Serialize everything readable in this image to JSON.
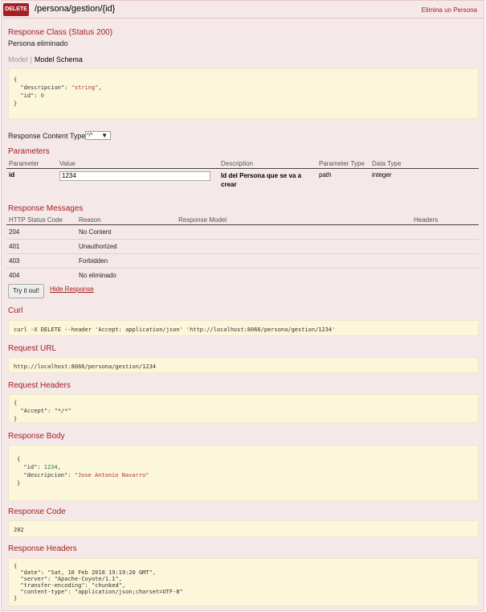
{
  "operation": {
    "method": "DELETE",
    "path": "/persona/gestion/{id}",
    "summary": "Elimina un Persona"
  },
  "response_class": {
    "title": "Response Class (Status 200)",
    "description": "Persona eliminado",
    "model_tab": "Model",
    "schema_tab": "Model Schema",
    "schema": {
      "descripcion": "string",
      "id": 0
    }
  },
  "content_type": {
    "label": "Response Content Type",
    "value": "*/*"
  },
  "parameters": {
    "title": "Parameters",
    "headers": [
      "Parameter",
      "Value",
      "Description",
      "Parameter Type",
      "Data Type"
    ],
    "rows": [
      {
        "name": "id",
        "value": "1234",
        "description": "Id del Persona que se va a crear",
        "param_type": "path",
        "data_type": "integer"
      }
    ]
  },
  "response_messages": {
    "title": "Response Messages",
    "headers": [
      "HTTP Status Code",
      "Reason",
      "Response Model",
      "Headers"
    ],
    "rows": [
      {
        "code": "204",
        "reason": "No Content"
      },
      {
        "code": "401",
        "reason": "Unauthorized"
      },
      {
        "code": "403",
        "reason": "Forbidden"
      },
      {
        "code": "404",
        "reason": "No eliminado"
      }
    ]
  },
  "actions": {
    "try_label": "Try it out!",
    "hide_label": "Hide Response"
  },
  "curl": {
    "title": "Curl",
    "value": "curl -X DELETE --header 'Accept: application/json' 'http://localhost:8066/persona/gestion/1234'"
  },
  "request_url": {
    "title": "Request URL",
    "value": "http://localhost:8066/persona/gestion/1234"
  },
  "request_headers": {
    "title": "Request Headers",
    "key": "Accept",
    "value": "*/*"
  },
  "response_body": {
    "title": "Response Body",
    "id_key": "id",
    "id_value": "1234",
    "desc_key": "descripcion",
    "desc_value": "Jose Antonio Navarro"
  },
  "response_code": {
    "title": "Response Code",
    "value": "202"
  },
  "response_headers": {
    "title": "Response Headers",
    "items": [
      {
        "key": "date",
        "value": "Sat, 10 Feb 2018 19:19:20 GMT"
      },
      {
        "key": "server",
        "value": "Apache-Coyote/1.1"
      },
      {
        "key": "transfer-encoding",
        "value": "chunked"
      },
      {
        "key": "content-type",
        "value": "application/json;charset=UTF-8"
      }
    ]
  },
  "colors": {
    "method_badge": "#a41e22",
    "heading_text": "#a41e22",
    "panel_bg": "#f5e8e8",
    "code_bg": "#fcf6db"
  }
}
